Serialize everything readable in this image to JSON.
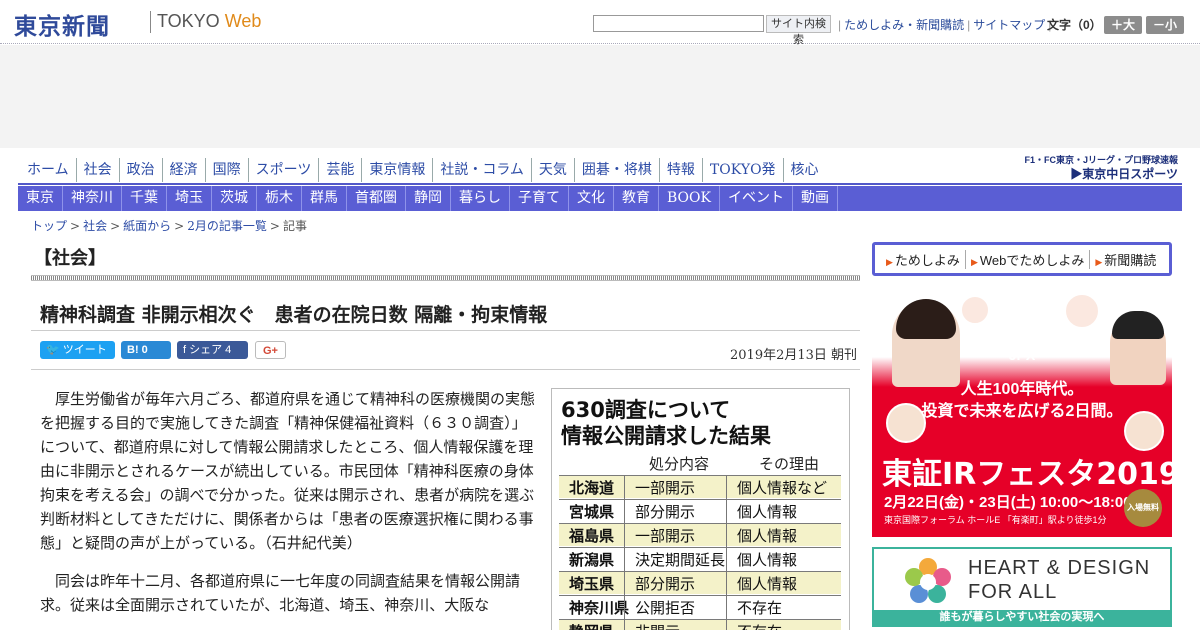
{
  "header": {
    "logo_ja": "東京新聞",
    "logo_en_prefix": "TOKYO ",
    "logo_en_suffix": "Web",
    "search_value": "",
    "search_button": "サイト内検索",
    "links": [
      "ためしよみ・新聞購読",
      "サイトマップ"
    ],
    "font_size_label": "文字（0）",
    "font_plus": "＋大",
    "font_minus": "－小"
  },
  "nav_main": [
    "ホーム",
    "社会",
    "政治",
    "経済",
    "国際",
    "スポーツ",
    "芸能",
    "東京情報",
    "社説・コラム",
    "天気",
    "囲碁・将棋",
    "特報",
    "TOKYO発",
    "核心"
  ],
  "sports_logo": {
    "line1": "F1・FC東京・Jリーグ・プロ野球速報",
    "line2": "▶東京中日スポーツ"
  },
  "nav_region": [
    "東京",
    "神奈川",
    "千葉",
    "埼玉",
    "茨城",
    "栃木",
    "群馬",
    "首都圏",
    "静岡",
    "暮らし",
    "子育て",
    "文化",
    "教育",
    "BOOK",
    "イベント",
    "動画"
  ],
  "breadcrumb": [
    "トップ",
    "社会",
    "紙面から",
    "2月の記事一覧",
    "記事"
  ],
  "section_title": "【社会】",
  "article": {
    "headline": "精神科調査 非開示相次ぐ　患者の在院日数 隔離・拘束情報",
    "date": "2019年2月13日 朝刊",
    "paragraphs": [
      "厚生労働省が毎年六月ごろ、都道府県を通じて精神科の医療機関の実態を把握する目的で実施してきた調査「精神保健福祉資料（６３０調査）」について、都道府県に対して情報公開請求したところ、個人情報保護を理由に非開示とされるケースが続出している。市民団体「精神科医療の身体拘束を考える会」の調べで分かった。従来は開示され、患者が病院を選ぶ判断材料としてきただけに、関係者からは「患者の医療選択権に関わる事態」と疑問の声が上がっている。（石井紀代美）",
      "同会は昨年十二月、各都道府県に一七年度の同調査結果を情報公開請求。従来は全面開示されていたが、北海道、埼玉、神奈川、大阪な"
    ]
  },
  "share": {
    "tweet": "ツイート",
    "hatena": "B! 0",
    "facebook": "シェア 4",
    "gplus": "G+"
  },
  "figure": {
    "title_line1": "630調査について",
    "title_line2": "情報公開請求した結果",
    "col_headers": [
      "処分内容",
      "その理由"
    ],
    "rows": [
      [
        "北海道",
        "一部開示",
        "個人情報など"
      ],
      [
        "宮城県",
        "部分開示",
        "個人情報"
      ],
      [
        "福島県",
        "一部開示",
        "個人情報"
      ],
      [
        "新潟県",
        "決定期間延長",
        "個人情報"
      ],
      [
        "埼玉県",
        "部分開示",
        "個人情報"
      ],
      [
        "神奈川県",
        "公開拒否",
        "不存在"
      ],
      [
        "静岡県",
        "非開示",
        "不存在"
      ]
    ]
  },
  "subscribe_box": [
    "ためしよみ",
    "Webでためしよみ",
    "新聞購読"
  ],
  "ad_jpx": {
    "logo": "JPX",
    "line1": "人生100年時代。",
    "line2": "投資で未来を広げる2日間。",
    "fest": "東証IRフェスタ2019",
    "date": "2月22日(金)・23日(土) 10:00～18:00",
    "venue": "東京国際フォーラム ホールE 「有楽町」駅より徒歩1分",
    "free": "入場無料"
  },
  "ad_heart": {
    "line1": "HEART & DESIGN",
    "line2": "FOR ALL",
    "band": "誰もが暮らしやすい社会の実現へ"
  },
  "colors": {
    "nav_blue": "#5a5ed4",
    "link_blue": "#2d4ca6",
    "jpx_red": "#e60028",
    "heart_green": "#3bb39c"
  }
}
